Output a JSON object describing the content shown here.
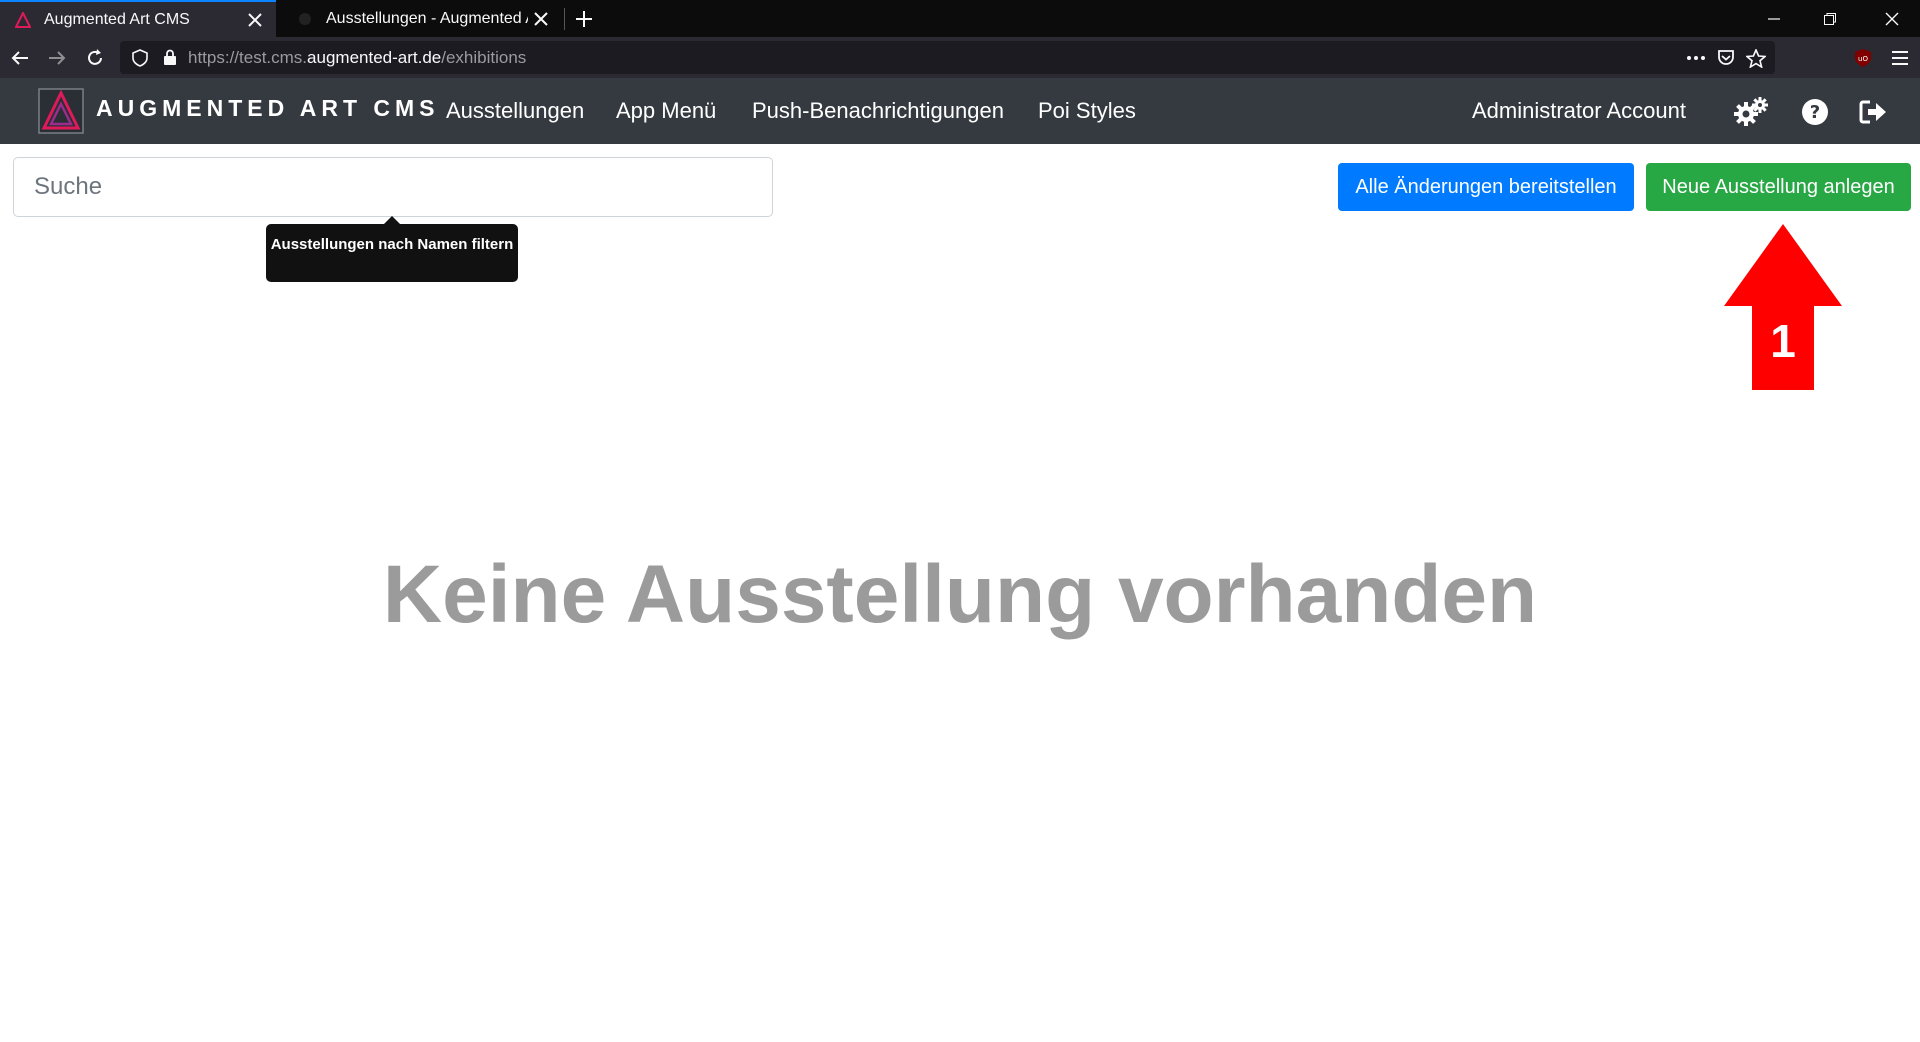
{
  "browser": {
    "tabs": [
      {
        "title": "Augmented Art CMS",
        "icon": "app-logo-icon",
        "active": true
      },
      {
        "title": "Ausstellungen - Augmented Art",
        "icon": "app-logo-icon",
        "active": false
      }
    ],
    "url_prefix": "https://test.cms.",
    "url_host": "augmented-art.de",
    "url_path": "/exhibitions"
  },
  "app": {
    "brand": "AUGMENTED ART CMS",
    "nav": [
      {
        "label": "Ausstellungen"
      },
      {
        "label": "App Menü"
      },
      {
        "label": "Push-Benachrichtigungen"
      },
      {
        "label": "Poi Styles"
      }
    ],
    "account": "Administrator Account",
    "colors": {
      "navbar": "#343a40",
      "primary": "#007bff",
      "success": "#28a745",
      "accent": "#e0195a"
    }
  },
  "search": {
    "placeholder": "Suche",
    "tooltip": "Ausstellungen nach Namen filtern"
  },
  "actions": {
    "deploy_label": "Alle Änderungen bereitstellen",
    "new_label": "Neue Ausstellung anlegen"
  },
  "annotation": {
    "label": "1",
    "color": "#ff0000"
  },
  "empty_state": "Keine Ausstellung vorhanden"
}
